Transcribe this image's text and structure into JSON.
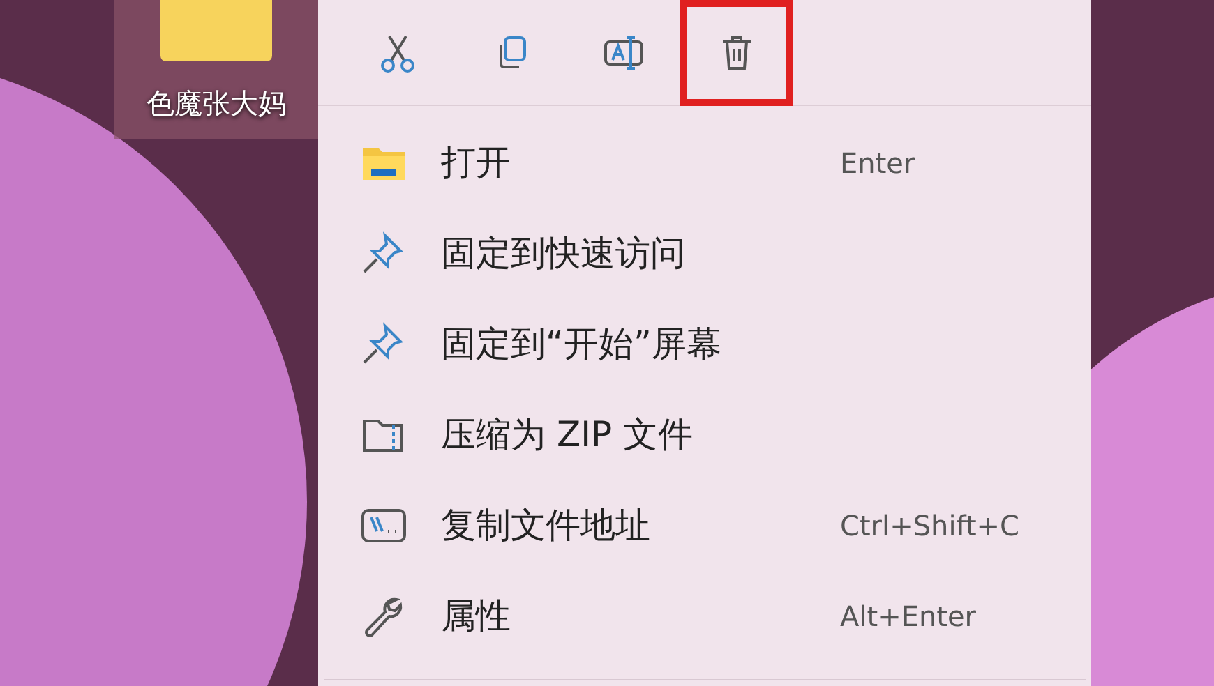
{
  "desktop_icon": {
    "label": "色魔张大妈",
    "selected": true
  },
  "toolbar": [
    {
      "highlighted": false
    },
    {
      "highlighted": false
    },
    {
      "highlighted": false
    },
    {
      "highlighted": true
    }
  ],
  "menu_items": [
    {
      "label": "打开",
      "shortcut": "Enter"
    },
    {
      "label": "固定到快速访问"
    },
    {
      "label": "固定到“开始”屏幕"
    },
    {
      "label": "压缩为 ZIP 文件"
    },
    {
      "label": "复制文件地址",
      "shortcut": "Ctrl+Shift+C"
    },
    {
      "label": "属性",
      "shortcut": "Alt+Enter"
    }
  ]
}
